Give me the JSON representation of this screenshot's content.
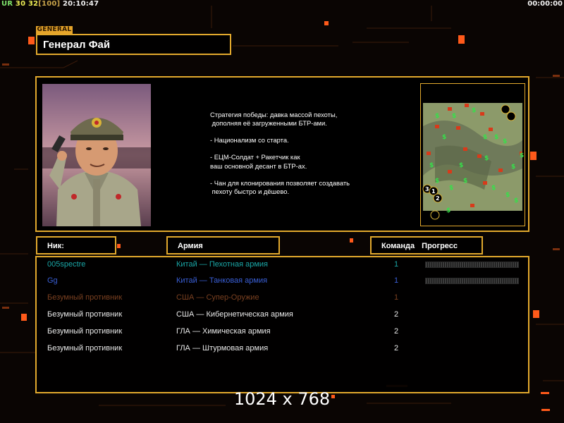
{
  "hud": {
    "ur": "UR",
    "fps_a": "30",
    "fps_b": "32",
    "cap": "[100]",
    "clock": "20:10:47",
    "timer": "00:00:00"
  },
  "general": {
    "tag": "GENERAL",
    "name": "Генерал Фай",
    "strategy": "Стратегия победы: давка массой пехоты,\n дополняя её загруженными БТР-ами.\n\n- Национализм со старта.\n\n- ЕЦМ-Солдат + Ракетчик как\nваш основной десант в БТР-ах.\n\n- Чан для клонирования позволяет создавать\n пехоту быстро и дёшево."
  },
  "minimap": {
    "start_positions": [
      "3",
      "1",
      "2"
    ]
  },
  "columns": {
    "nick": "Ник:",
    "army": "Армия",
    "team": "Команда",
    "progress": "Прогресс"
  },
  "players": [
    {
      "nick": "005spectre",
      "army": "Китай — Пехотная армия",
      "team": "1",
      "color": "#1aa6a6",
      "progress": 0
    },
    {
      "nick": "Gg",
      "army": "Китай — Танковая армия",
      "team": "1",
      "color": "#3a5fd6",
      "progress": 0
    },
    {
      "nick": "Безумный противник",
      "army": "США — Супер-Оружие",
      "team": "1",
      "color": "#7a4020",
      "progress": null
    },
    {
      "nick": "Безумный противник",
      "army": "США — Кибернетическая армия",
      "team": "2",
      "color": "#e8e8e8",
      "progress": null
    },
    {
      "nick": "Безумный противник",
      "army": "ГЛА — Химическая армия",
      "team": "2",
      "color": "#e8e8e8",
      "progress": null
    },
    {
      "nick": "Безумный противник",
      "army": "ГЛА — Штурмовая армия",
      "team": "2",
      "color": "#e8e8e8",
      "progress": null
    }
  ],
  "resolution_label": "1024 x 768",
  "colors": {
    "frame": "#e2a92d",
    "background": "#0a0503",
    "accent_orange": "#ff5a1a"
  }
}
